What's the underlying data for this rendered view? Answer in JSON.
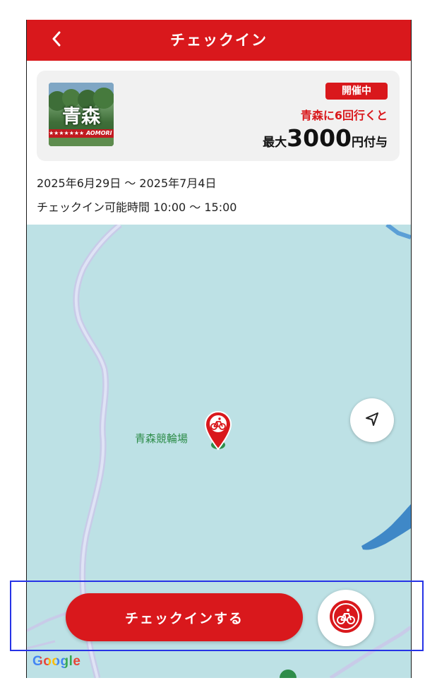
{
  "header": {
    "title": "チェックイン",
    "back_icon": "chevron-left-icon"
  },
  "event": {
    "thumbnail": {
      "title": "青森",
      "band_text": "★★★★★★★ AOMORI"
    },
    "badge": "開催中",
    "promo": "青森に6回行くと",
    "reward_prefix": "最大",
    "reward_amount": "3000",
    "reward_suffix": "円付与",
    "dates": "2025年6月29日 〜 2025年7月4日",
    "hours": "チェックイン可能時間 10:00 〜 15:00"
  },
  "map": {
    "place_label": "青森競輪場",
    "locate_icon": "navigation-arrow-icon",
    "pin_icon": "bicycle-icon",
    "attribution": "Google"
  },
  "actions": {
    "checkin_label": "チェックインする",
    "bike_icon": "bicycle-icon"
  },
  "colors": {
    "accent": "#d9181c",
    "map_water": "#bde1e5",
    "map_road": "#c8cbe8",
    "label_green": "#2e8d4a",
    "highlight_box": "#2633e6"
  }
}
